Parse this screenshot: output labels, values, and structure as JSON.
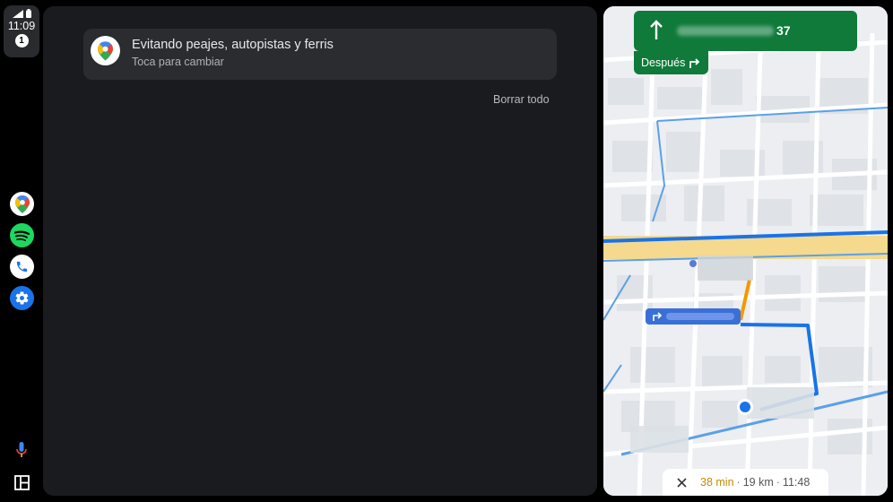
{
  "status": {
    "time": "11:09",
    "badge": "1"
  },
  "rail": {
    "apps": [
      "maps-icon",
      "spotify-icon",
      "phone-icon",
      "settings-icon"
    ],
    "tools": [
      "microphone-icon",
      "layout-icon"
    ]
  },
  "notification": {
    "title": "Evitando peajes, autopistas y ferris",
    "subtitle": "Toca para cambiar"
  },
  "clear_all": "Borrar todo",
  "navigation": {
    "distance_suffix": "37",
    "then_label": "Después"
  },
  "eta": {
    "minutes": "38 min",
    "distance": "19 km",
    "arrival": "11:48",
    "separator": "·"
  },
  "colors": {
    "nav_green": "#0f7a3a",
    "route_blue": "#1a73e8",
    "eta_orange": "#c68a00"
  }
}
